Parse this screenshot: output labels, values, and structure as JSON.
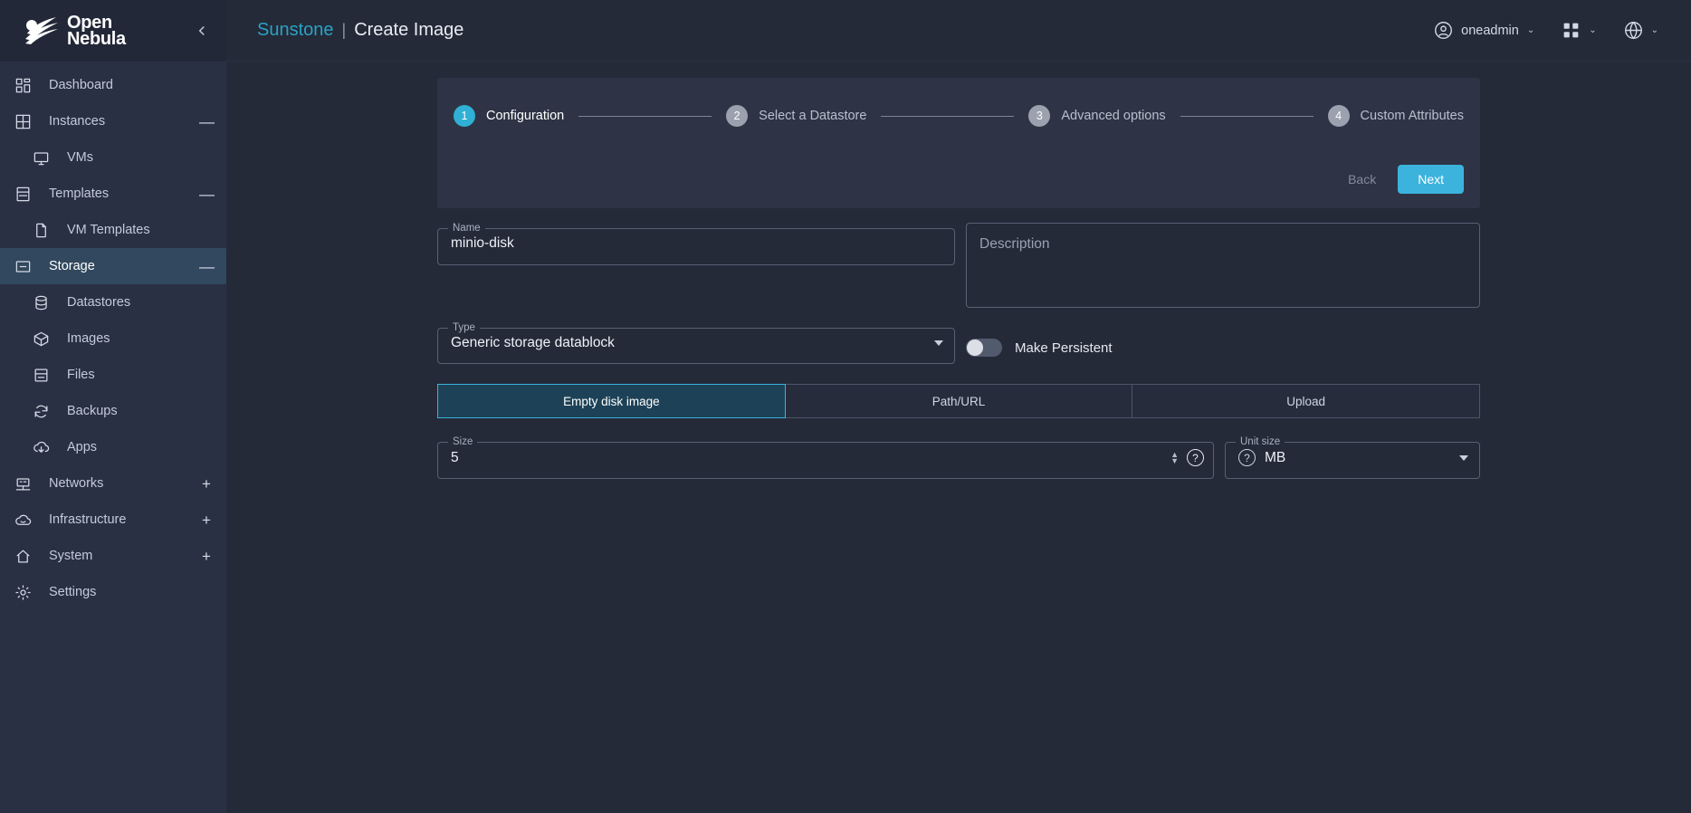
{
  "brand": {
    "line1": "Open",
    "line2": "Nebula",
    "collapse_icon": "chevron-left-icon"
  },
  "sidebar": {
    "items": [
      {
        "label": "Dashboard",
        "icon": "dashboard-icon",
        "level": 0,
        "expand": "",
        "active": false
      },
      {
        "label": "Instances",
        "icon": "grid-icon",
        "level": 0,
        "expand": "—",
        "active": false
      },
      {
        "label": "VMs",
        "icon": "monitor-icon",
        "level": 1,
        "expand": "",
        "active": false
      },
      {
        "label": "Templates",
        "icon": "template-icon",
        "level": 0,
        "expand": "—",
        "active": false
      },
      {
        "label": "VM Templates",
        "icon": "file-icon",
        "level": 1,
        "expand": "",
        "active": false
      },
      {
        "label": "Storage",
        "icon": "storage-icon",
        "level": 0,
        "expand": "—",
        "active": true
      },
      {
        "label": "Datastores",
        "icon": "database-icon",
        "level": 1,
        "expand": "",
        "active": false
      },
      {
        "label": "Images",
        "icon": "box-icon",
        "level": 1,
        "expand": "",
        "active": false
      },
      {
        "label": "Files",
        "icon": "files-icon",
        "level": 1,
        "expand": "",
        "active": false
      },
      {
        "label": "Backups",
        "icon": "refresh-icon",
        "level": 1,
        "expand": "",
        "active": false
      },
      {
        "label": "Apps",
        "icon": "cloud-download-icon",
        "level": 1,
        "expand": "",
        "active": false
      },
      {
        "label": "Networks",
        "icon": "network-icon",
        "level": 0,
        "expand": "+",
        "active": false
      },
      {
        "label": "Infrastructure",
        "icon": "cloud-icon",
        "level": 0,
        "expand": "+",
        "active": false
      },
      {
        "label": "System",
        "icon": "home-icon",
        "level": 0,
        "expand": "+",
        "active": false
      },
      {
        "label": "Settings",
        "icon": "gear-icon",
        "level": 0,
        "expand": "",
        "active": false
      }
    ]
  },
  "topbar": {
    "app_name": "Sunstone",
    "separator": "|",
    "page_title": "Create Image",
    "user": "oneadmin",
    "user_icon": "user-circle-icon",
    "apps_icon": "apps-grid-icon",
    "language_icon": "globe-icon",
    "caret": "⌄"
  },
  "wizard": {
    "steps": [
      {
        "num": "1",
        "label": "Configuration",
        "current": true
      },
      {
        "num": "2",
        "label": "Select a Datastore",
        "current": false
      },
      {
        "num": "3",
        "label": "Advanced options",
        "current": false
      },
      {
        "num": "4",
        "label": "Custom Attributes",
        "current": false
      }
    ],
    "back_label": "Back",
    "next_label": "Next"
  },
  "form": {
    "name": {
      "legend": "Name",
      "value": "minio-disk",
      "placeholder": ""
    },
    "description": {
      "placeholder": "Description",
      "value": ""
    },
    "type": {
      "legend": "Type",
      "value": "Generic storage datablock"
    },
    "persistent": {
      "label": "Make Persistent",
      "on": false
    },
    "source_tabs": [
      {
        "label": "Empty disk image",
        "active": true
      },
      {
        "label": "Path/URL",
        "active": false
      },
      {
        "label": "Upload",
        "active": false
      }
    ],
    "size": {
      "legend": "Size",
      "value": "5",
      "help_icon": "question-circle-icon"
    },
    "unit": {
      "legend": "Unit size",
      "value": "MB",
      "help_icon": "question-circle-icon"
    }
  },
  "colors": {
    "accent": "#3cb3dd",
    "sidebar_bg": "#2a3044",
    "page_bg": "#242a38",
    "card_bg": "#2e3445",
    "active_item": "#31485e"
  }
}
